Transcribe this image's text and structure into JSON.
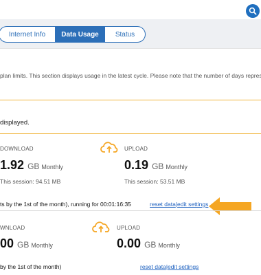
{
  "header": {
    "search_icon": "search-icon",
    "accent": "#1f6fbf"
  },
  "tabs": [
    {
      "label": "Internet Info",
      "active": false
    },
    {
      "label": "Data Usage",
      "active": true
    },
    {
      "label": "Status",
      "active": false
    }
  ],
  "intro_text": "plan limits. This section displays usage in the latest cycle. Please note that the number of days represe",
  "notice_text": "displayed.",
  "usage_primary": {
    "download": {
      "label": "DOWNLOAD",
      "amount": "1.92",
      "unit": "GB",
      "period": "Monthly",
      "session": "This session: 94.51 MB"
    },
    "upload": {
      "label": "UPLOAD",
      "amount": "0.19",
      "unit": "GB",
      "period": "Monthly",
      "session": "This session: 53.51 MB"
    },
    "cycle_text": "ts by the 1st of the month), running for 00:01:16:35",
    "reset_label": "reset data",
    "edit_label": "edit settings"
  },
  "usage_secondary": {
    "download": {
      "label": "WNLOAD",
      "amount": "00",
      "unit": "GB",
      "period": "Monthly"
    },
    "upload": {
      "label": "UPLOAD",
      "amount": "0.00",
      "unit": "GB",
      "period": "Monthly"
    },
    "cycle_text": "by the 1st of the month)",
    "reset_label": "reset data",
    "edit_label": "edit settings"
  },
  "colors": {
    "accent_blue": "#2c6fb8",
    "highlight_orange": "#f5a623",
    "rule_yellow": "#f0b43a"
  }
}
